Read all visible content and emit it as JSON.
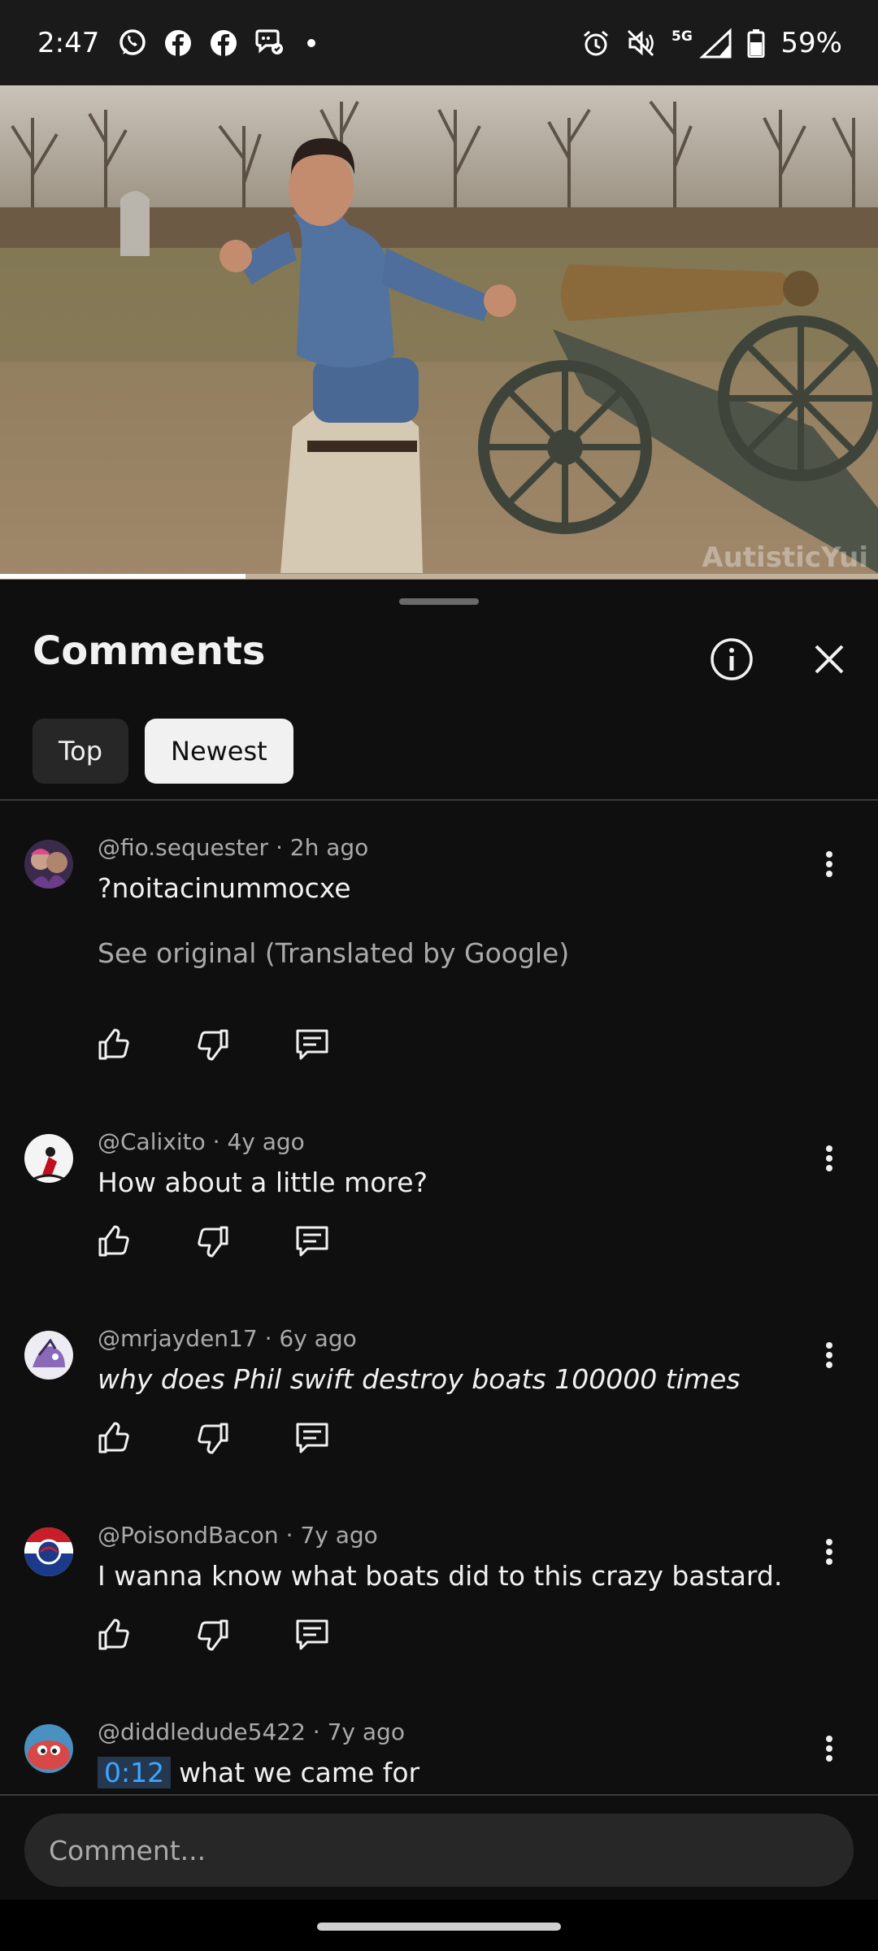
{
  "status_bar": {
    "time": "2:47",
    "left_icons": [
      "whatsapp-icon",
      "facebook-icon",
      "facebook-icon",
      "messenger-icon"
    ],
    "network": "5G",
    "battery": "59%"
  },
  "video": {
    "watermark": "AutisticYui",
    "progress_fraction": 0.28
  },
  "comments_panel": {
    "title": "Comments",
    "filters": [
      {
        "label": "Top",
        "selected": false
      },
      {
        "label": "Newest",
        "selected": true
      }
    ],
    "comments": [
      {
        "author": "@fio.sequester",
        "age": "2h ago",
        "text": "?noitacinummocxe",
        "translation_note": "See original (Translated by Google)"
      },
      {
        "author": "@Calixito",
        "age": "4y ago",
        "text": "How about a little more?"
      },
      {
        "author": "@mrjayden17",
        "age": "6y ago",
        "text": "why does Phil swift destroy boats 100000 times"
      },
      {
        "author": "@PoisondBacon",
        "age": "7y ago",
        "text": "I wanna know what boats did to this crazy bastard."
      },
      {
        "author": "@diddledude5422",
        "age": "7y ago",
        "timestamp": "0:12",
        "text": "what we came for"
      }
    ],
    "input_placeholder": "Comment..."
  },
  "colors": {
    "background": "#0f0f0f",
    "secondary_text": "#aaaaaa",
    "timestamp_link": "#3ea6ff"
  }
}
